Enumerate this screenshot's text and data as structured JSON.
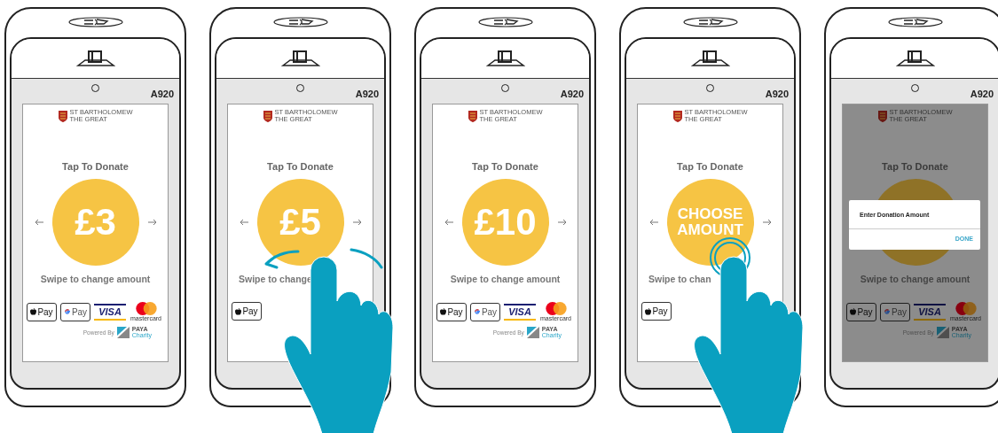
{
  "terminals": [
    {
      "kind": "amount",
      "model": "A920",
      "logo_lines": [
        "ST BARTHOLOMEW",
        "THE GREAT"
      ],
      "heading": "Tap To Donate",
      "amount": "£3",
      "swipe_text": "Swipe to change amount",
      "payments": [
        {
          "kind": "apple_pay",
          "label": "Pay"
        },
        {
          "kind": "google_pay",
          "label": "Pay"
        },
        {
          "kind": "visa",
          "label": "VISA"
        },
        {
          "kind": "mastercard",
          "label": "mastercard"
        }
      ],
      "powered_by": {
        "label": "Powered By",
        "brand": "PAYA",
        "brand_sub": "Charity"
      }
    },
    {
      "kind": "amount",
      "model": "A920",
      "logo_lines": [
        "ST BARTHOLOMEW",
        "THE GREAT"
      ],
      "heading": "Tap To Donate",
      "amount": "£5",
      "swipe_text": "Swipe to change",
      "payments": [
        {
          "kind": "apple_pay",
          "label": "Pay"
        }
      ],
      "hand": {
        "kind": "swipe"
      }
    },
    {
      "kind": "amount",
      "model": "A920",
      "logo_lines": [
        "ST BARTHOLOMEW",
        "THE GREAT"
      ],
      "heading": "Tap To Donate",
      "amount": "£10",
      "swipe_text": "Swipe to change amount",
      "payments": [
        {
          "kind": "apple_pay",
          "label": "Pay"
        },
        {
          "kind": "google_pay",
          "label": "Pay"
        },
        {
          "kind": "visa",
          "label": "VISA"
        },
        {
          "kind": "mastercard",
          "label": "mastercard"
        }
      ],
      "powered_by": {
        "label": "Powered By",
        "brand": "PAYA",
        "brand_sub": "Charity"
      }
    },
    {
      "kind": "choose",
      "model": "A920",
      "logo_lines": [
        "ST BARTHOLOMEW",
        "THE GREAT"
      ],
      "heading": "Tap To Donate",
      "amount": "CHOOSE AMOUNT",
      "swipe_text": "Swipe to chan",
      "payments": [
        {
          "kind": "apple_pay",
          "label": "Pay"
        }
      ],
      "hand": {
        "kind": "tap"
      }
    },
    {
      "kind": "dialog",
      "model": "A920",
      "logo_lines": [
        "ST BARTHOLOMEW",
        "THE GREAT"
      ],
      "heading": "Tap To Donate",
      "swipe_text": "Swipe to change amount",
      "payments": [
        {
          "kind": "apple_pay",
          "label": "Pay"
        },
        {
          "kind": "google_pay",
          "label": "Pay"
        },
        {
          "kind": "visa",
          "label": "VISA"
        },
        {
          "kind": "mastercard",
          "label": "mastercard"
        }
      ],
      "powered_by": {
        "label": "Powered By",
        "brand": "PAYA",
        "brand_sub": "Charity"
      },
      "dialog": {
        "title": "Enter Donation Amount",
        "button": "DONE"
      }
    }
  ]
}
